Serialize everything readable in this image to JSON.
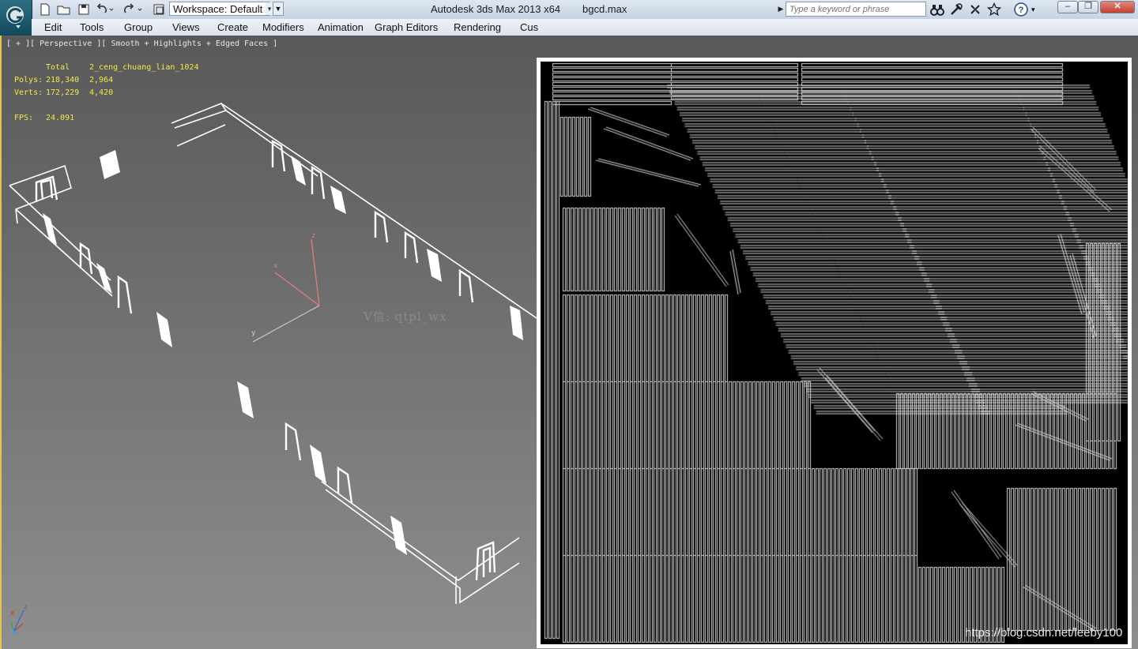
{
  "titlebar": {
    "workspace_label": "Workspace: Default",
    "app_title": "Autodesk 3ds Max  2013 x64",
    "file_name": "bgcd.max",
    "search_placeholder": "Type a keyword or phrase"
  },
  "menu": [
    "Edit",
    "Tools",
    "Group",
    "Views",
    "Create",
    "Modifiers",
    "Animation",
    "Graph Editors",
    "Rendering",
    "Cus"
  ],
  "viewport": {
    "label": "[ + ][ Perspective ][ Smooth + Highlights + Edged Faces ]",
    "stats": {
      "header_total": "Total",
      "header_object": "2_ceng_chuang_lian_1024",
      "polys_label": "Polys:",
      "polys_total": "218,340",
      "polys_object": "2,964",
      "verts_label": "Verts:",
      "verts_total": "172,229",
      "verts_object": "4,420",
      "fps_label": "FPS:",
      "fps_value": "24.091"
    },
    "gizmo_labels": {
      "x": "x",
      "y": "y",
      "z": "z"
    },
    "watermark": "V信: qtpl_wx"
  },
  "credit": "https://blog.csdn.net/leeby100",
  "icons": [
    "app-logo-icon",
    "new-file-icon",
    "open-file-icon",
    "save-icon",
    "undo-icon",
    "redo-icon",
    "project-folder-icon",
    "binoculars-icon",
    "subscription-icon",
    "communication-icon",
    "favorites-icon",
    "help-icon",
    "minimize-icon",
    "restore-icon",
    "close-icon"
  ],
  "colors": {
    "stats_text": "#f2e84b",
    "viewport_border": "#e0c64a",
    "render_bg": "#000000",
    "render_lines": "#d8d8d8"
  }
}
